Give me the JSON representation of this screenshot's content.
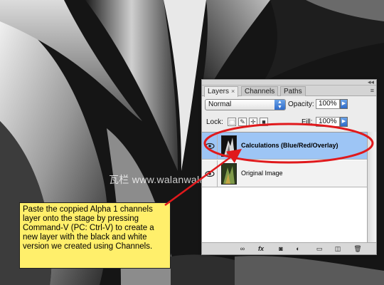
{
  "layers_panel": {
    "tabs": [
      {
        "label": "Layers",
        "close": "×"
      },
      {
        "label": "Channels"
      },
      {
        "label": "Paths"
      }
    ],
    "menu_icon": "≡",
    "blend_mode": "Normal",
    "opacity_label": "Opacity:",
    "opacity_value": "100%",
    "lock_label": "Lock:",
    "fill_label": "Fill:",
    "fill_value": "100%",
    "layers": [
      {
        "name": "Calculations (Blue/Red/Overlay)",
        "selected": true
      },
      {
        "name": "Original Image",
        "selected": false
      }
    ],
    "bottom_icons": [
      "link-icon",
      "fx-icon",
      "mask-icon",
      "adjustment-icon",
      "group-icon",
      "new-layer-icon",
      "trash-icon"
    ],
    "fx_label": "fx"
  },
  "callout": {
    "text": "Paste the coppied Alpha 1 channels layer onto the stage by pressing Command-V (PC: Ctrl-V) to create a new layer with the black and white version we created using Channels."
  },
  "watermark": "瓦栏 www.walanwalan.com",
  "colors": {
    "selected_layer": "#9dc5f5",
    "callout_bg": "#ffef6b",
    "annotation_red": "#e0191c"
  }
}
